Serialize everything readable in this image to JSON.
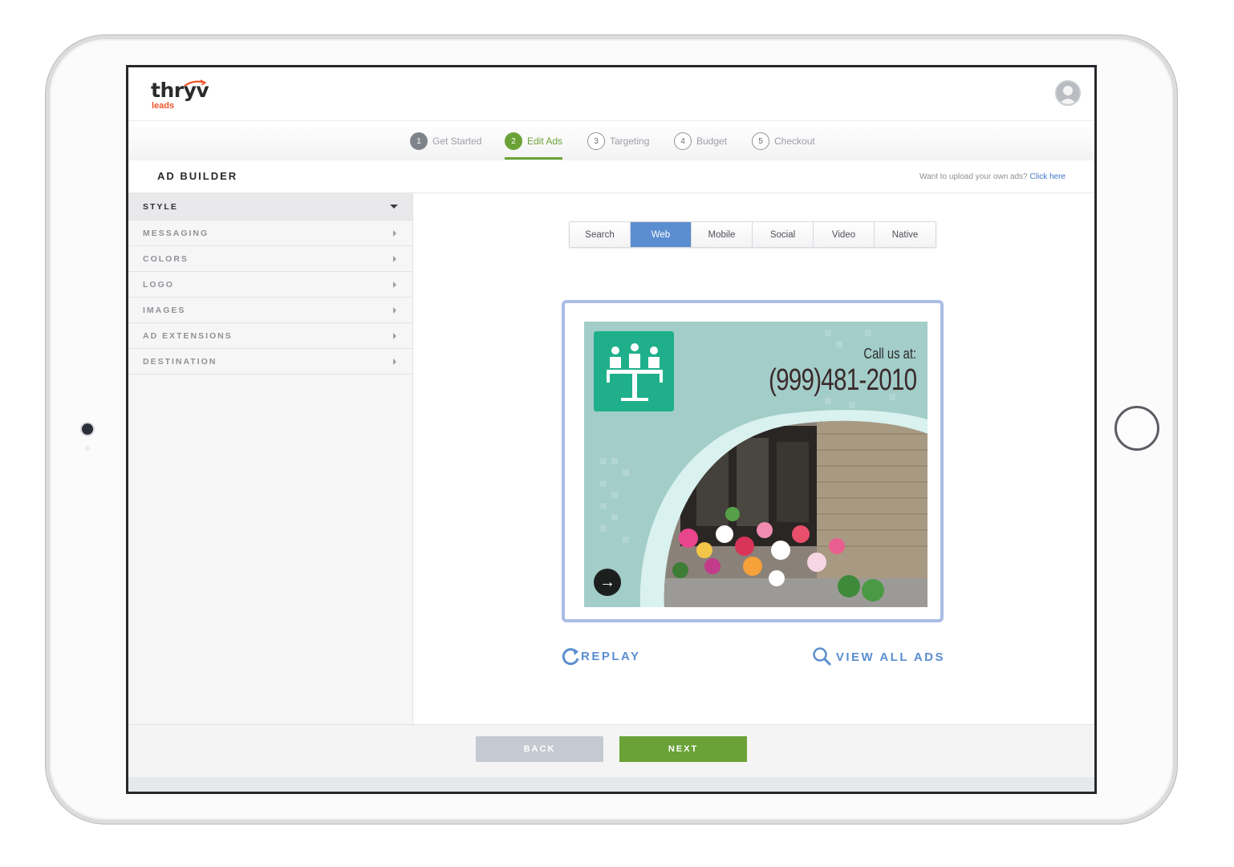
{
  "brand": {
    "name": "thryv",
    "sub": "leads",
    "accent": "#f0542b"
  },
  "steps": [
    {
      "num": "1",
      "label": "Get Started",
      "state": "done"
    },
    {
      "num": "2",
      "label": "Edit Ads",
      "state": "active"
    },
    {
      "num": "3",
      "label": "Targeting",
      "state": "todo"
    },
    {
      "num": "4",
      "label": "Budget",
      "state": "todo"
    },
    {
      "num": "5",
      "label": "Checkout",
      "state": "todo"
    }
  ],
  "builder": {
    "title": "AD BUILDER",
    "upload_prompt": "Want to upload your own ads?",
    "upload_link": "Click here"
  },
  "sidebar": {
    "items": [
      {
        "label": "STYLE",
        "open": true
      },
      {
        "label": "MESSAGING"
      },
      {
        "label": "COLORS"
      },
      {
        "label": "LOGO"
      },
      {
        "label": "IMAGES"
      },
      {
        "label": "AD EXTENSIONS"
      },
      {
        "label": "DESTINATION"
      }
    ]
  },
  "tabs": [
    {
      "label": "Search"
    },
    {
      "label": "Web",
      "active": true
    },
    {
      "label": "Mobile"
    },
    {
      "label": "Social"
    },
    {
      "label": "Video"
    },
    {
      "label": "Native"
    }
  ],
  "ad": {
    "call_label": "Call us at:",
    "phone": "(999)481-2010",
    "bg_color": "#a3cdc9",
    "logo_color": "#1fb08b"
  },
  "actions": {
    "replay": "REPLAY",
    "view_all": "VIEW ALL ADS"
  },
  "footer": {
    "back": "BACK",
    "next": "NEXT"
  },
  "colors": {
    "green": "#6aa237",
    "blue": "#5b8ed0"
  }
}
